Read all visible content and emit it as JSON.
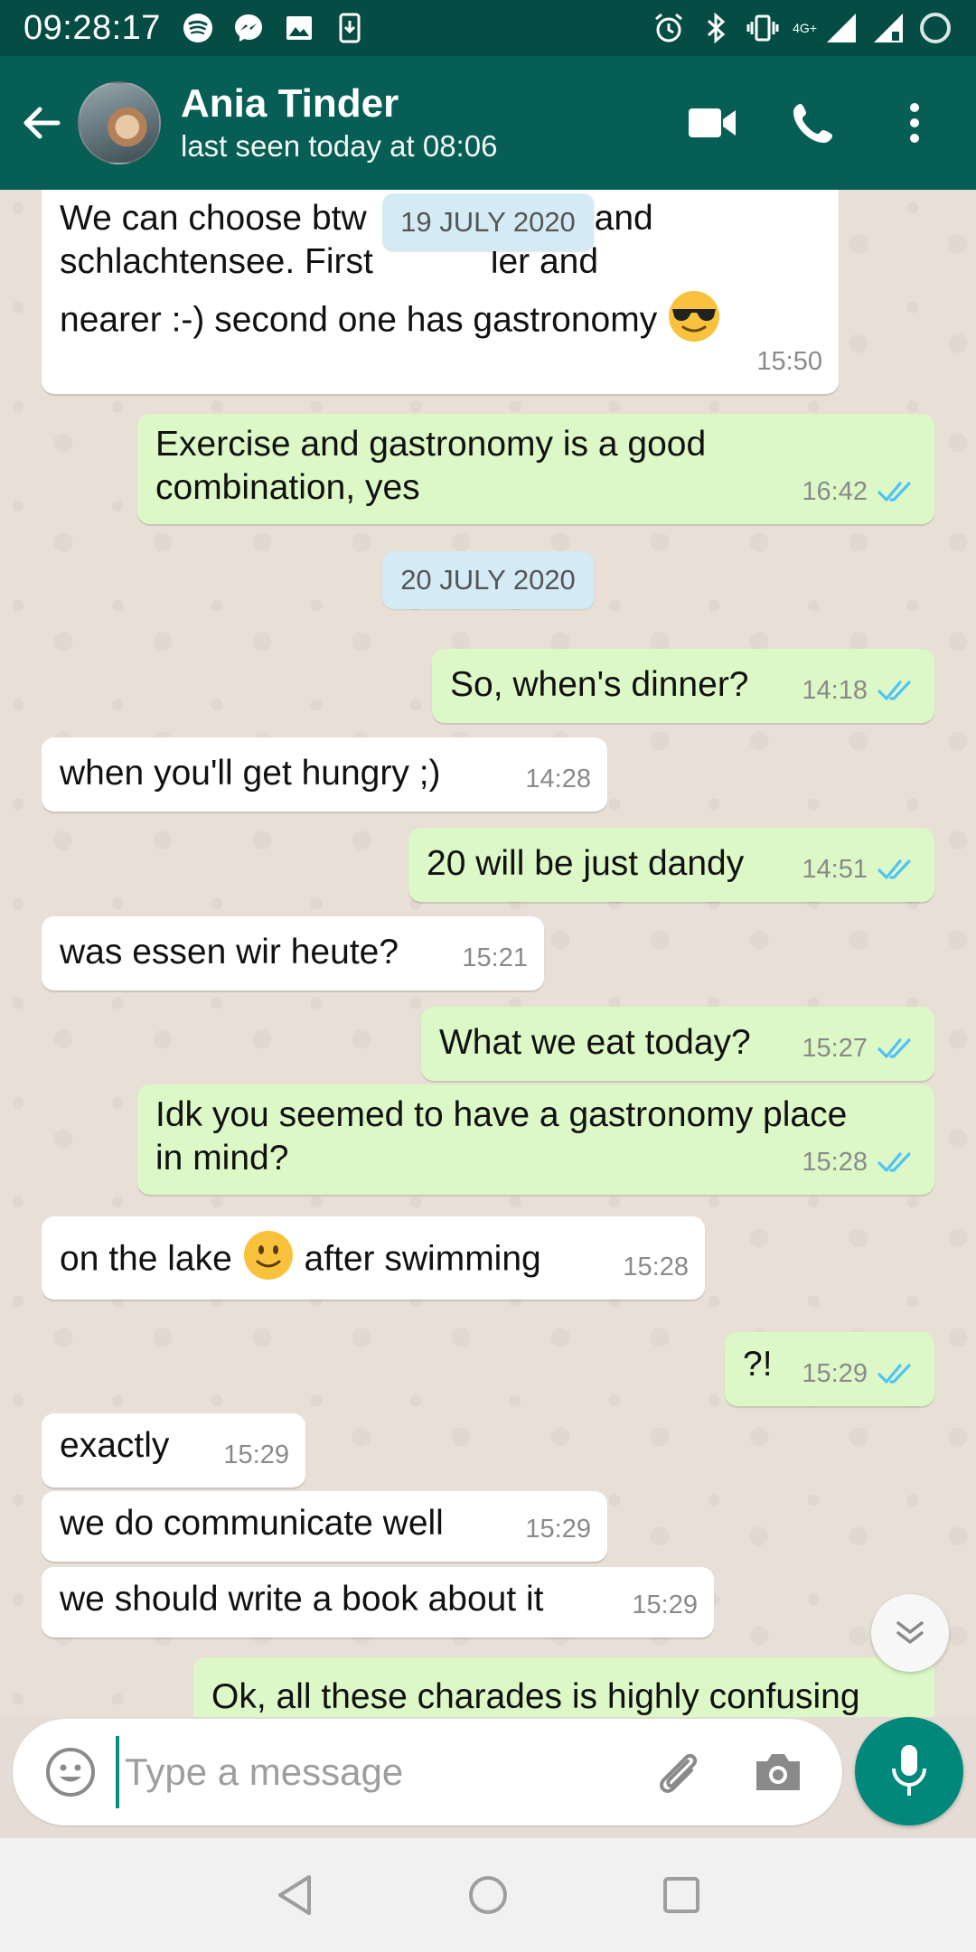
{
  "status_bar": {
    "time": "09:28:17",
    "network": "4G+"
  },
  "header": {
    "contact_name": "Ania Tinder",
    "last_seen": "last seen today at 08:06"
  },
  "chat": {
    "messages": [
      {
        "dir": "in",
        "text": "We can choose btw",
        "line1_tail": "ke and",
        "line2": "schlachtensee. First",
        "line2_tail": "ler and",
        "line3": "nearer :-) second one has gastronomy",
        "time": "15:50"
      },
      {
        "dir": "out",
        "line1": "Exercise and gastronomy is a good",
        "line2": "combination, yes",
        "time": "16:42"
      },
      {
        "dir": "out",
        "text": "So, when's dinner?",
        "time": "14:18"
      },
      {
        "dir": "in",
        "text": "when you'll get hungry ;)",
        "time": "14:28"
      },
      {
        "dir": "out",
        "text": "20 will be just dandy",
        "time": "14:51"
      },
      {
        "dir": "in",
        "text": "was essen wir heute?",
        "time": "15:21"
      },
      {
        "dir": "out",
        "text": "What we eat today?",
        "time": "15:27"
      },
      {
        "dir": "out",
        "line1": "Idk you seemed to have a gastronomy place",
        "line2": "in mind?",
        "time": "15:28"
      },
      {
        "dir": "in",
        "text_a": "on the lake",
        "text_b": "after swimming",
        "time": "15:28"
      },
      {
        "dir": "out",
        "text": "?!",
        "time": "15:29"
      },
      {
        "dir": "in",
        "text": "exactly",
        "time": "15:29"
      },
      {
        "dir": "in",
        "text": "we do communicate well",
        "time": "15:29"
      },
      {
        "dir": "in",
        "text": "we should write a book about it",
        "time": "15:29"
      },
      {
        "dir": "out",
        "text": "Ok, all these charades is highly confusing"
      }
    ],
    "dates": [
      "19 JULY 2020",
      "20 JULY 2020"
    ]
  },
  "composer": {
    "placeholder": "Type a message"
  },
  "colors": {
    "header": "#075e54",
    "status_bar": "#054d44",
    "outgoing_bubble": "#dcf8c6",
    "incoming_bubble": "#ffffff",
    "read_tick": "#4fc3f7",
    "mic_button": "#00897b",
    "date_chip": "#d4eaf4"
  },
  "icons": [
    "spotify-icon",
    "messenger-icon",
    "image-icon",
    "download-icon",
    "alarm-icon",
    "bluetooth-icon",
    "vibrate-icon",
    "signal-icon",
    "battery-icon",
    "back-arrow-icon",
    "video-call-icon",
    "phone-call-icon",
    "more-vert-icon",
    "emoji-icon",
    "attach-icon",
    "camera-icon",
    "mic-icon",
    "scroll-down-icon",
    "nav-back-icon",
    "nav-home-icon",
    "nav-recents-icon"
  ]
}
